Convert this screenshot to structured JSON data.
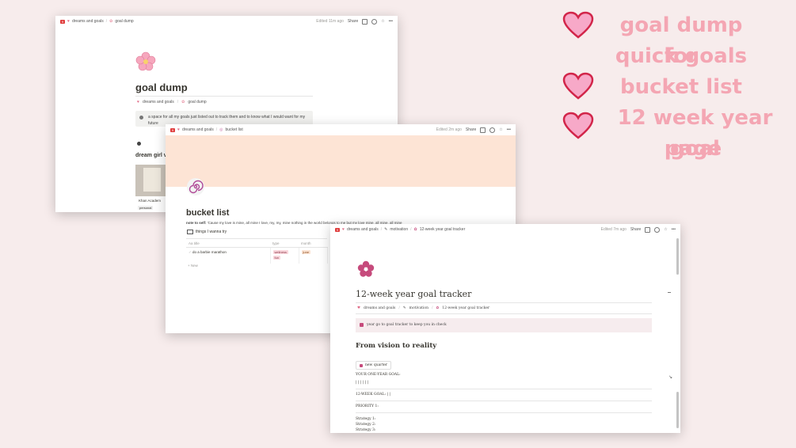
{
  "windows": {
    "goal_dump": {
      "topbar": {
        "badge": "9",
        "crumbs": [
          "dreams and goals",
          "goal dump"
        ],
        "edited": "Edited 11m ago",
        "share": "Share"
      },
      "title": "goal dump",
      "breadcrumb": [
        "dreams and goals",
        "goal dump"
      ],
      "callout": "a space for all my goals just listed out to track them and to know what I would want for my future",
      "section_heading": "dream girl v",
      "card_label": "Khan Academ",
      "card_tag": "personal"
    },
    "bucket_list": {
      "topbar": {
        "badge": "9",
        "crumbs": [
          "dreams and goals",
          "bucket list"
        ],
        "edited": "Edited 2m ago",
        "share": "Share"
      },
      "title": "bucket list",
      "note_label": "note to self:",
      "note_text": "'Cause my love is mine, all mine I love, my, my, mine nothing in the world belongs to me but my love mine, all mine, all mine",
      "db_title": "things I wanna try",
      "columns": [
        "Aa title",
        "type",
        "month"
      ],
      "rows": [
        {
          "title": "do a barbie marathon",
          "tags": [
            "wellness",
            "fun"
          ],
          "month": "june"
        }
      ],
      "new_label": "+ New"
    },
    "goal_tracker": {
      "topbar": {
        "badge": "9",
        "crumbs": [
          "dreams and goals",
          "motivation",
          "12-week year goal tracker"
        ],
        "edited": "Edited 7m ago",
        "share": "Share"
      },
      "title": "12-week year goal tracker",
      "breadcrumb": [
        "dreams and goals",
        "motivation",
        "12-week year goal tracker"
      ],
      "callout": "year go to goal tracker to keep you in check",
      "heading": "From vision to reality",
      "button": "new quarter",
      "form": {
        "one_year": "YOUR ONE-YEAR GOAL:",
        "blanks": "| | | | | |",
        "twelve_week": "12-WEEK GOAL: | |",
        "priority": "PRIORITY 1:",
        "strategy1": "Strategy 1:",
        "strategy2": "Strategy 2:",
        "strategy3": "Strategy 3:"
      }
    }
  },
  "promo": {
    "line1": "goal dump for",
    "line2": "quick goals",
    "line3": "bucket list",
    "line4": "12 week year goal",
    "line5": "page",
    "heart_fill": "#f7a9c8",
    "heart_stroke": "#d2264a",
    "text_color": "#f4a6b3"
  }
}
